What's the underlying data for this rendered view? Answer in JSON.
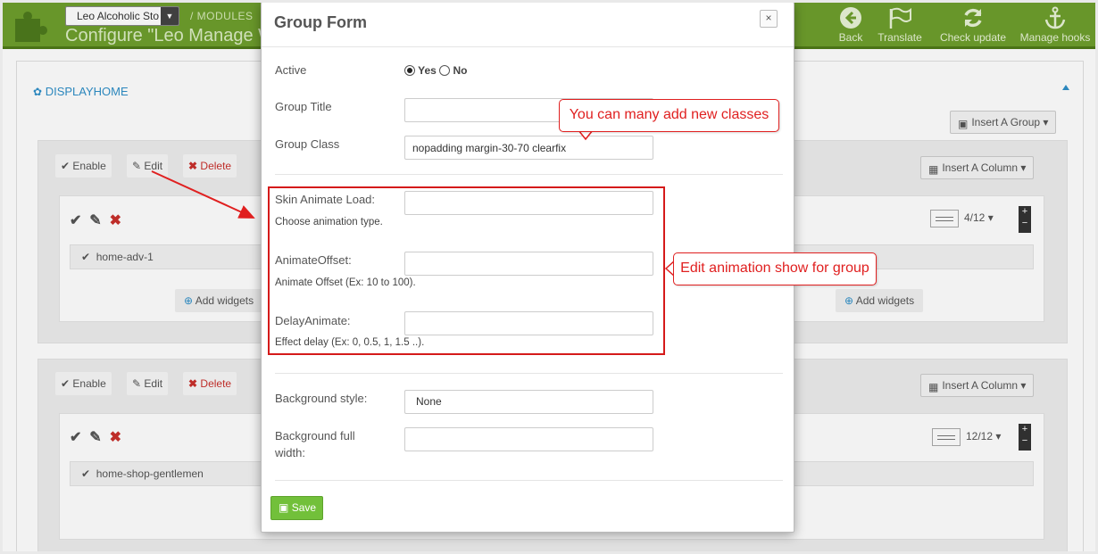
{
  "header": {
    "shop_select": "Leo Alcoholic Sto",
    "breadcrumb": "/   MODULES",
    "title": "Configure \"Leo Manage W",
    "toolbar": [
      {
        "id": "back",
        "label": "Back",
        "icon": "back-icon"
      },
      {
        "id": "translate",
        "label": "Translate",
        "icon": "flag-icon"
      },
      {
        "id": "check",
        "label": "Check update",
        "icon": "refresh-icon"
      },
      {
        "id": "hooks",
        "label": "Manage hooks",
        "icon": "anchor-icon"
      }
    ]
  },
  "panel": {
    "title": "DISPLAYHOME",
    "insert_group": "Insert A Group",
    "groups": [
      {
        "actions": {
          "enable": "Enable",
          "edit": "Edit",
          "delete": "Delete"
        },
        "insert_column": "Insert A Column",
        "width": "4/12",
        "widget": "home-adv-1",
        "add_widgets": "Add widgets"
      },
      {
        "actions": {
          "enable": "Enable",
          "edit": "Edit",
          "delete": "Delete"
        },
        "insert_column": "Insert A Column",
        "width": "12/12",
        "widget": "home-shop-gentlemen"
      }
    ]
  },
  "modal": {
    "title": "Group Form",
    "close": "×",
    "active_label": "Active",
    "active_yes": "Yes",
    "active_no": "No",
    "active_value": "yes",
    "group_title_label": "Group Title",
    "group_title_value": "",
    "group_class_label": "Group Class",
    "group_class_value": "nopadding margin-30-70 clearfix",
    "skin_label": "Skin Animate Load:",
    "skin_help": "Choose animation type.",
    "skin_value": "",
    "offset_label": "AnimateOffset:",
    "offset_help": "Animate Offset (Ex: 10 to 100).",
    "offset_value": "",
    "delay_label": "DelayAnimate:",
    "delay_help": "Effect delay (Ex: 0, 0.5, 1, 1.5 ..).",
    "delay_value": "",
    "bg_style_label": "Background style:",
    "bg_style_value": "None",
    "bg_full_label": "Background full width:",
    "bg_full_value": "",
    "save": "Save"
  },
  "annotations": {
    "classes_callout": "You can many add new classes",
    "animation_callout": "Edit animation show for group"
  },
  "colors": {
    "header_green": "#6e9f2d",
    "save_green": "#72c03a",
    "annotation_red": "#e02020",
    "link_blue": "#2f8fc8",
    "delete_red": "#c9302c"
  }
}
